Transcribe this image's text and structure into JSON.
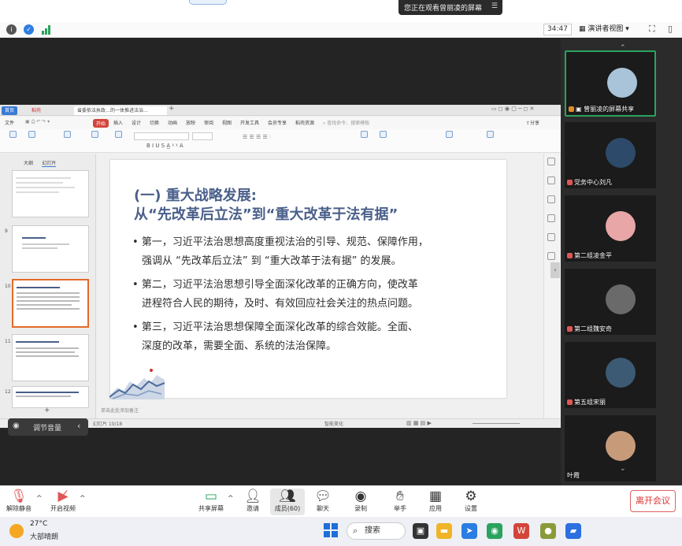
{
  "share_banner": "您正在观看曾丽凌的屏幕",
  "toolbar": {
    "timer": "34:47",
    "speaker_view": "演讲者视图",
    "speaker_view_arrow": "▾"
  },
  "wps": {
    "tabs": [
      "首页",
      "稻壳",
      "省委依法执政…的一体推进法治…"
    ],
    "menu": [
      "文件",
      "开始",
      "插入",
      "设计",
      "切换",
      "动画",
      "放映",
      "审阅",
      "视图",
      "开发工具",
      "会员专享",
      "稻壳资源"
    ],
    "search_hint": "查找命令、搜索模板",
    "share": "分享",
    "thumb_tabs": [
      "大纲",
      "幻灯片"
    ],
    "thumb_numbers": [
      "9",
      "10",
      "11",
      "12"
    ],
    "notes_placeholder": "单击此处添加备注",
    "status_left": "幻灯片 10/18",
    "status_right": "智能美化",
    "new_btn": "+"
  },
  "slide": {
    "title_line1": "(一) 重大战略发展:",
    "title_line2": "从“先改革后立法”到“重大改革于法有据”",
    "bullets": [
      "第一，习近平法治思想高度重视法治的引导、规范、保障作用，",
      "强调从 “先改革后立法” 到 “重大改革于法有据” 的发展。",
      "第二，习近平法治思想引导全面深化改革的正确方向，使改革",
      "进程符合人民的期待，及时、有效回应社会关注的热点问题。",
      "第三，习近平法治思想保障全面深化改革的综合效能。全面、",
      "深度的改革，需要全面、系统的法治保障。"
    ]
  },
  "mute_popup": "调节音量",
  "participants": [
    {
      "name": "曾丽凌的屏幕共享",
      "color": "#a9c4d8"
    },
    {
      "name": "党务中心刘凡",
      "color": "#2d4a6a"
    },
    {
      "name": "第二组凌金平",
      "color": "#e8a6a6"
    },
    {
      "name": "第二组魏安奇",
      "color": "#6a6a6a"
    },
    {
      "name": "第五组宋丽",
      "color": "#3c5a74"
    },
    {
      "name": "叶霞",
      "color": "#c79b7a"
    }
  ],
  "meeting_bar": {
    "mute": "解除静音",
    "video": "开启视频",
    "share": "共享屏幕",
    "invite": "邀请",
    "members": "成员(60)",
    "chat": "聊天",
    "record": "录制",
    "raise_hand": "举手",
    "apps": "应用",
    "settings": "设置",
    "leave": "离开会议"
  },
  "taskbar": {
    "temp": "27°C",
    "weather": "大部晴朗",
    "search": "搜索"
  }
}
